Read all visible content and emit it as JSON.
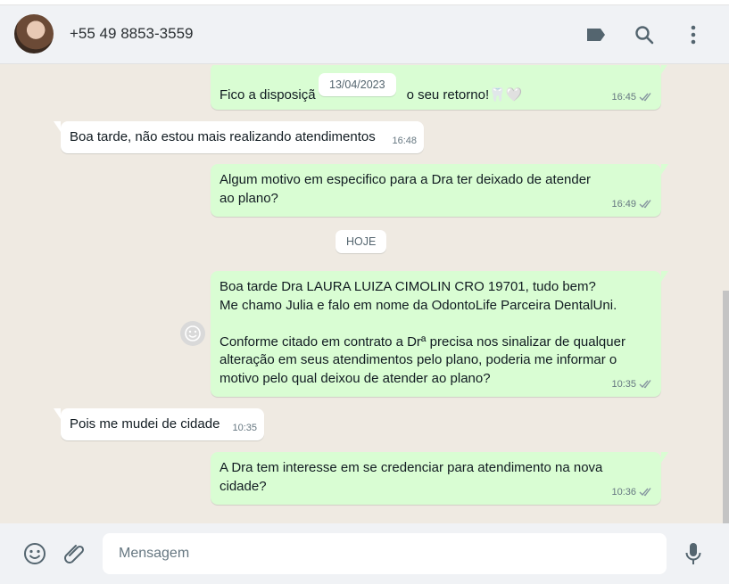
{
  "header": {
    "contact_name": "+55 49 8853-3559",
    "icons": [
      "label-icon",
      "search-icon",
      "menu-icon"
    ]
  },
  "chat": {
    "date_separators": [
      "13/04/2023",
      "HOJE"
    ],
    "messages": [
      {
        "direction": "out",
        "text": "Fico a disposição, aguardo seu retorno!🦷🤍",
        "visible_text_before": "Fico a disposiçã",
        "visible_text_after": "o seu retorno!🦷🤍",
        "time": "16:45",
        "status": "read"
      },
      {
        "direction": "in",
        "text": "Boa tarde, não estou mais realizando atendimentos",
        "time": "16:48"
      },
      {
        "direction": "out",
        "text": "Algum motivo em especifico para a Dra ter deixado de atender ao plano?",
        "time": "16:49",
        "status": "read"
      },
      {
        "direction": "out",
        "text": "Boa tarde Dra LAURA LUIZA CIMOLIN CRO 19701, tudo bem?\nMe chamo Julia e falo em nome da OdontoLife Parceira DentalUni.\n\nConforme citado em contrato a Drª precisa nos sinalizar de qualquer alteração em seus atendimentos pelo plano, poderia me informar o motivo pelo qual deixou de atender ao plano?",
        "time": "10:35",
        "status": "read"
      },
      {
        "direction": "in",
        "text": "Pois me mudei de cidade",
        "time": "10:35"
      },
      {
        "direction": "out",
        "text": "A Dra tem interesse em se credenciar para atendimento na nova cidade?",
        "time": "10:36",
        "status": "read"
      }
    ]
  },
  "composer": {
    "placeholder": "Mensagem",
    "value": "",
    "icons": [
      "emoji-icon",
      "attach-icon",
      "microphone-icon"
    ]
  },
  "colors": {
    "outgoing_bubble": "#d9fdd3",
    "incoming_bubble": "#ffffff",
    "chat_background": "#efeae2",
    "header_background": "#f0f2f5",
    "read_tick": "#53bdeb"
  }
}
